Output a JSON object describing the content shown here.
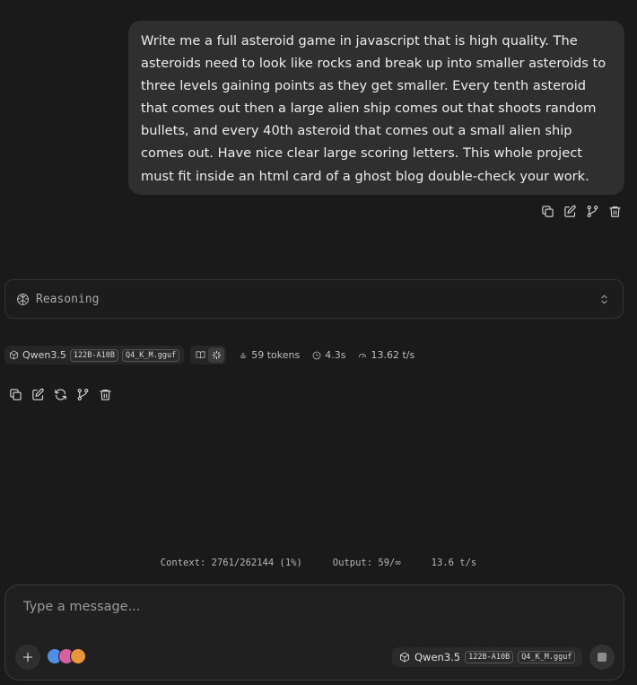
{
  "user_message": {
    "text": "Write me a full asteroid game in javascript that is high quality. The asteroids need to look like rocks and break up into smaller asteroids to three levels gaining points as they get smaller. Every tenth asteroid that comes out then a large alien ship comes out that shoots random bullets, and every 40th asteroid that comes out a small alien ship comes out. Have nice clear large scoring letters. This whole project must fit inside an html card of a ghost blog double-check your work.",
    "actions": [
      "copy-icon",
      "edit-icon",
      "branch-icon",
      "delete-icon"
    ]
  },
  "reasoning": {
    "label": "Reasoning"
  },
  "response_meta": {
    "model_name": "Qwen3.5",
    "model_tag_size": "122B-A10B",
    "model_tag_quant": "Q4_K_M.gguf",
    "tokens": "59 tokens",
    "time": "4.3s",
    "speed": "13.62 t/s",
    "actions": [
      "copy-icon",
      "edit-icon",
      "regenerate-icon",
      "branch-icon",
      "delete-icon"
    ]
  },
  "status_bar": {
    "context": "Context: 2761/262144 (1%)",
    "output": "Output: 59/∞",
    "rate": "13.6 t/s"
  },
  "composer": {
    "placeholder": "Type a message...",
    "model_name": "Qwen3.5",
    "model_tag_size": "122B-A10B",
    "model_tag_quant": "Q4_K_M.gguf"
  },
  "colors": {
    "background": "#1a1a1a",
    "bubble": "#2f2f2f",
    "composer": "#202020"
  }
}
